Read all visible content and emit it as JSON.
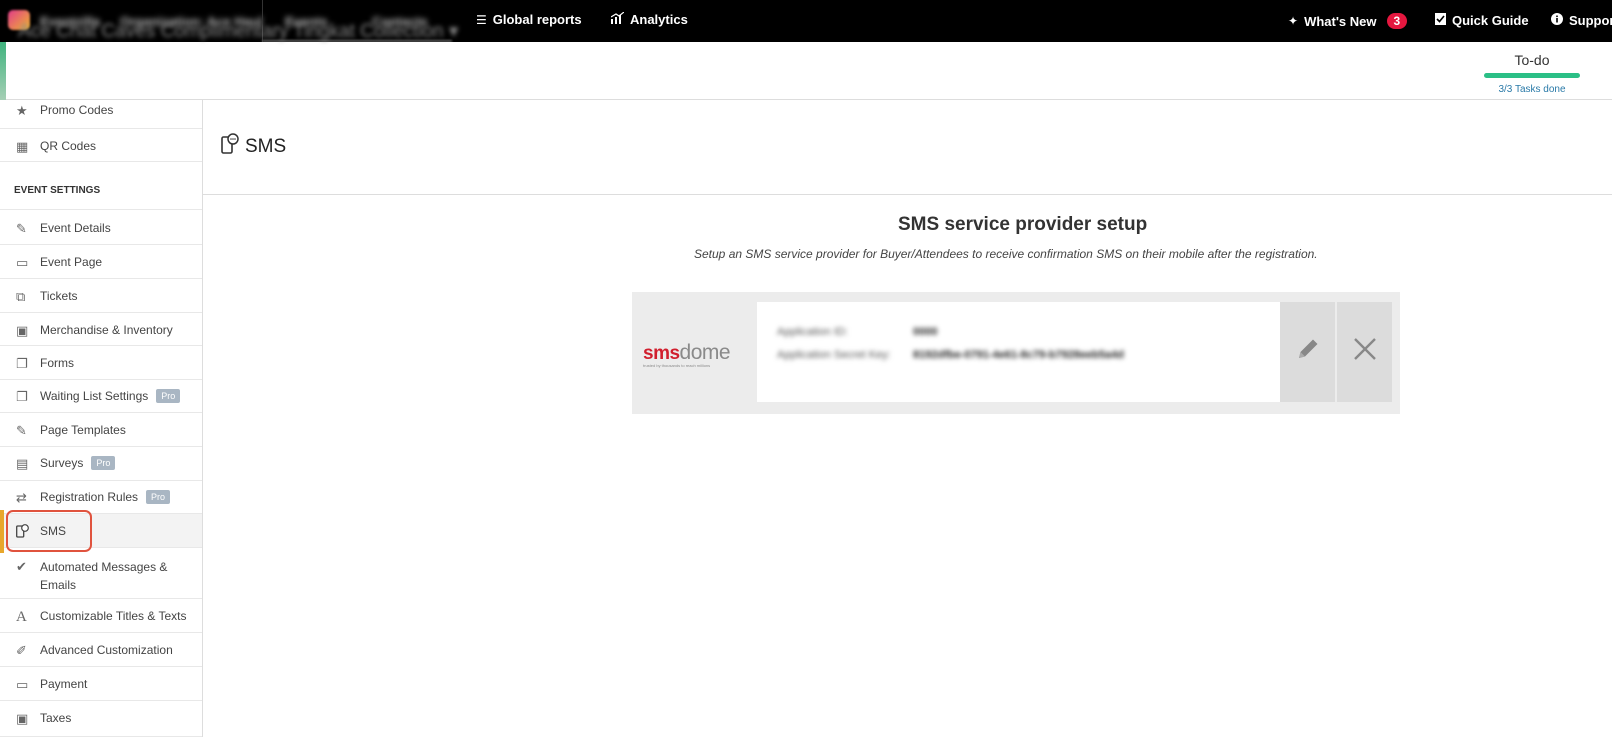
{
  "topbar": {
    "brand": "Eventzilla",
    "organization": "Organization: Ace Haul",
    "events": "Events",
    "contacts": "Contacts",
    "global_reports": "Global reports",
    "analytics": "Analytics",
    "whats_new": "What's New",
    "whats_new_count": "3",
    "quick_guide": "Quick Guide",
    "support": "Suppor"
  },
  "subheader": {
    "event_title": "Ace Chat Caves Complimentary Tingkat Collection",
    "todo_label": "To-do",
    "todo_progress": 1.0,
    "todo_status": "3/3 Tasks done"
  },
  "sidebar": {
    "section_label": "EVENT SETTINGS",
    "items": [
      {
        "label": "Promo Codes",
        "icon": "star-icon"
      },
      {
        "label": "QR Codes",
        "icon": "qr-code-icon"
      },
      {
        "label": "Event Details",
        "icon": "edit-icon"
      },
      {
        "label": "Event Page",
        "icon": "monitor-icon"
      },
      {
        "label": "Tickets",
        "icon": "ticket-icon"
      },
      {
        "label": "Merchandise & Inventory",
        "icon": "briefcase-icon"
      },
      {
        "label": "Forms",
        "icon": "forms-icon"
      },
      {
        "label": "Waiting List Settings",
        "icon": "copy-icon",
        "pro": "Pro"
      },
      {
        "label": "Page Templates",
        "icon": "edit-icon"
      },
      {
        "label": "Surveys",
        "icon": "document-icon",
        "pro": "Pro"
      },
      {
        "label": "Registration Rules",
        "icon": "shuffle-icon",
        "pro": "Pro"
      },
      {
        "label": "SMS",
        "icon": "sms-icon"
      },
      {
        "label": "Automated Messages & Emails",
        "icon": "check-circle-icon"
      },
      {
        "label": "Customizable Titles & Texts",
        "icon": "font-icon"
      },
      {
        "label": "Advanced Customization",
        "icon": "wrench-icon"
      },
      {
        "label": "Payment",
        "icon": "credit-card-icon"
      },
      {
        "label": "Taxes",
        "icon": "money-icon"
      }
    ]
  },
  "main": {
    "page_title": "SMS",
    "setup_title": "SMS service provider setup",
    "setup_description": "Setup an SMS service provider for Buyer/Attendees to receive confirmation SMS on their mobile after the registration.",
    "provider": {
      "logo_sms": "sms",
      "logo_dome": "dome",
      "logo_tagline": "trusted by thousands to reach millions",
      "app_id_label": "Application ID:",
      "app_id_value": "0000",
      "secret_label": "Application Secret Key:",
      "secret_value": "8192dfbe-0791-4e61-8c79-b7928eeb5a4d"
    }
  }
}
